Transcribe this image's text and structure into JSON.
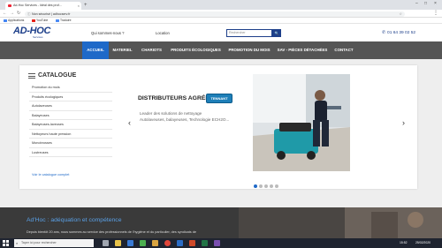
{
  "browser": {
    "tab_title": "Ad-Hoc Services - Idéal des prof...",
    "tab_close": "×",
    "new_tab": "+",
    "address": "Non sécurisé | adhocserv.fr",
    "star": "☆",
    "menu": "⋮",
    "bookmarks": [
      "Applications",
      "YouTube",
      "Traduire"
    ]
  },
  "header": {
    "logo": "AD-HOC",
    "logo_sub": "Services",
    "links": [
      "Qui sommes-nous ?",
      "Location"
    ],
    "search_placeholder": "Rechercher",
    "search_icon": "🔍",
    "phone": "01 64 39 02 52"
  },
  "nav": {
    "items": [
      "ACCUEIL",
      "MATERIEL",
      "CHARIOTS",
      "PRODUITS ÉCOLOGIQUES",
      "PROMOTION DU MOIS",
      "SAV - PIÈCES DÉTACHÉES",
      "CONTACT"
    ],
    "active_color": "#1e69c8"
  },
  "catalogue": {
    "title": "CATALOGUE",
    "items": [
      "Promotion du mois",
      "Produits écologiques",
      "Autolaveuses",
      "Balayeuses",
      "Balayeuses-laveuses",
      "Nettoyeurs haute pression",
      "Monobrosses",
      "Lustreuses"
    ],
    "more": "Voir le catalogue complet"
  },
  "slider": {
    "title": "DISTRIBUTEURS AGRÉES",
    "brand": "TENNANT",
    "desc_line1": "Leader des solutions de nettoyage",
    "desc_line2": "Autolaveuses, balayeuses, Technologie ECH2O...",
    "prev": "‹",
    "next": "›",
    "active_dot": 0
  },
  "about": {
    "title": "Ad'Hoc : adéquation et compétence",
    "text": "Depuis bientôt 20 ans, nous sommes au service des professionnels de l'hygiène et du particulier, des syndicats de"
  },
  "taskbar": {
    "search": "Taper ici pour rechercher",
    "time": "15:52",
    "date": "25/02/2020"
  }
}
